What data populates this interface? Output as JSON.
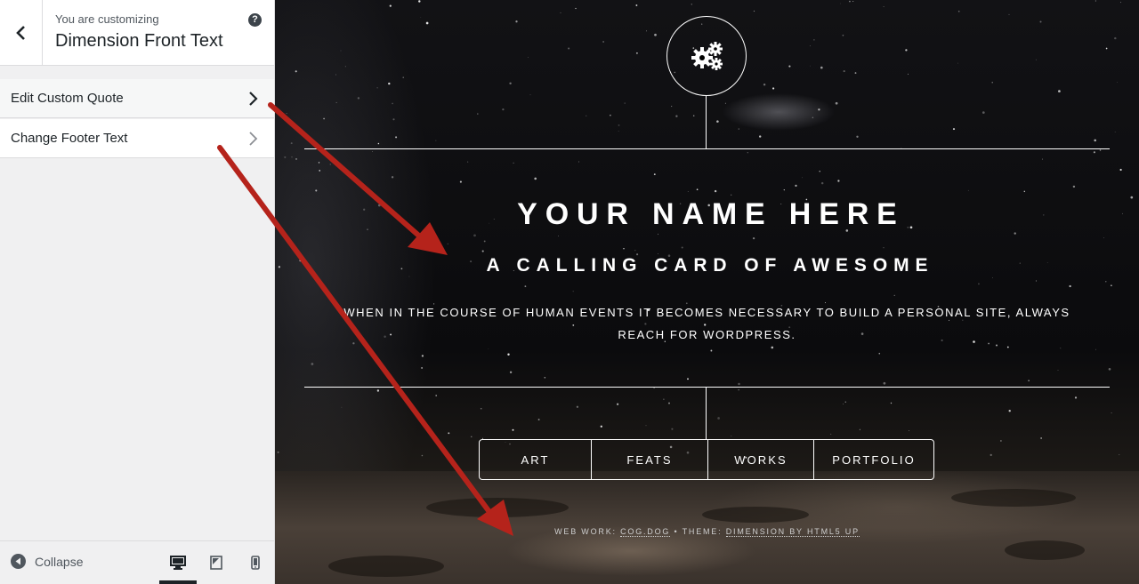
{
  "sidebar": {
    "customizing_label": "You are customizing",
    "customizing_title": "Dimension Front Text",
    "help_glyph": "?",
    "sections": [
      {
        "label": "Edit Custom Quote"
      },
      {
        "label": "Change Footer Text"
      }
    ],
    "collapse_label": "Collapse"
  },
  "site": {
    "name": "YOUR NAME HERE",
    "tagline": "A CALLING CARD OF AWESOME",
    "quote": "WHEN IN THE COURSE OF HUMAN EVENTS IT BECOMES NECESSARY TO BUILD A PERSONAL SITE, ALWAYS REACH FOR WORDPRESS.",
    "nav": [
      {
        "label": "ART"
      },
      {
        "label": "FEATS"
      },
      {
        "label": "WORKS"
      },
      {
        "label": "PORTFOLIO"
      }
    ],
    "footer": {
      "prefix": "WEB WORK: ",
      "link1": "COG.DOG",
      "separator": " • THEME: ",
      "link2": "DIMENSION BY HTML5 UP"
    }
  },
  "icons": {
    "back": "chevron-left-icon",
    "help": "question-icon",
    "logo": "gears-icon",
    "collapse": "collapse-arrow-icon",
    "desktop": "desktop-icon",
    "tablet": "tablet-icon",
    "mobile": "mobile-icon"
  },
  "colors": {
    "annotation_arrow": "#b5231b",
    "sidebar_bg": "#f0f0f1"
  }
}
